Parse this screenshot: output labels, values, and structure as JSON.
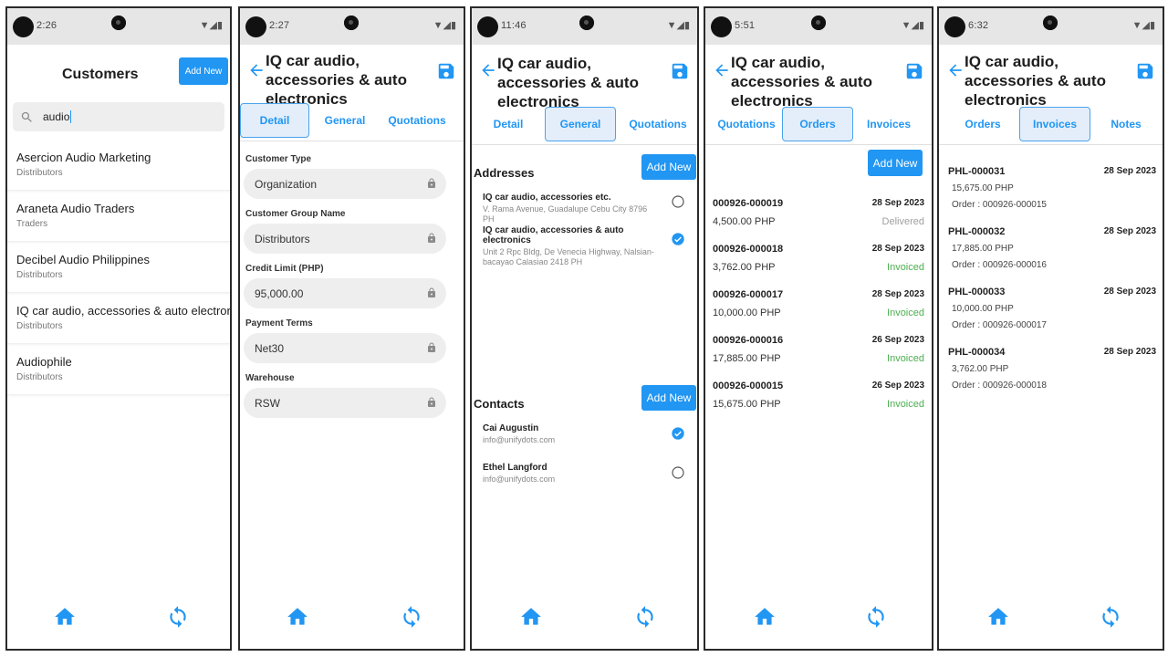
{
  "colors": {
    "accent": "#2196f3",
    "delivered": "#9e9e9e",
    "invoiced": "#4caf50"
  },
  "screen1": {
    "status_time": "2:26",
    "title": "Customers",
    "add_new": "Add New",
    "search_value": "audio",
    "customers": [
      {
        "name": "Asercion Audio Marketing",
        "group": "Distributors"
      },
      {
        "name": "Araneta Audio Traders",
        "group": "Traders"
      },
      {
        "name": "Decibel Audio Philippines",
        "group": "Distributors"
      },
      {
        "name": "IQ car audio, accessories & auto electronics",
        "group": "Distributors"
      },
      {
        "name": "Audiophile",
        "group": "Distributors"
      }
    ]
  },
  "screen2": {
    "status_time": "2:27",
    "title": "IQ car audio, accessories & auto electronics",
    "tabs": [
      "Detail",
      "General",
      "Quotations"
    ],
    "fields": [
      {
        "label": "Customer Type",
        "value": "Organization"
      },
      {
        "label": "Customer Group Name",
        "value": "Distributors"
      },
      {
        "label": "Credit Limit (PHP)",
        "value": "95,000.00"
      },
      {
        "label": "Payment Terms",
        "value": "Net30"
      },
      {
        "label": "Warehouse",
        "value": "RSW"
      }
    ]
  },
  "screen3": {
    "status_time": "11:46",
    "title": "IQ car audio, accessories & auto electronics",
    "tabs": [
      "Detail",
      "General",
      "Quotations"
    ],
    "addresses_heading": "Addresses",
    "contacts_heading": "Contacts",
    "add_new": "Add New",
    "addresses": [
      {
        "name": "IQ car audio, accessories etc.",
        "line": "V. Rama Avenue, Guadalupe  Cebu City  8796 PH",
        "selected": false
      },
      {
        "name": "IQ car audio, accessories & auto electronics",
        "line": "Unit 2 Rpc Bldg, De Venecia Highway, Nalsian-bacayao  Calasiao  2418 PH",
        "selected": true
      }
    ],
    "contacts": [
      {
        "name": "Cai Augustin",
        "email": "info@unifydots.com",
        "selected": true
      },
      {
        "name": "Ethel Langford",
        "email": "info@unifydots.com",
        "selected": false
      }
    ]
  },
  "screen4": {
    "status_time": "5:51",
    "title": "IQ car audio, accessories & auto electronics",
    "tabs": [
      "Quotations",
      "Orders",
      "Invoices"
    ],
    "add_new": "Add New",
    "orders": [
      {
        "number": "000926-000019",
        "date": "28 Sep 2023",
        "amount": "4,500.00 PHP",
        "status": "Delivered"
      },
      {
        "number": "000926-000018",
        "date": "28 Sep 2023",
        "amount": "3,762.00 PHP",
        "status": "Invoiced"
      },
      {
        "number": "000926-000017",
        "date": "28 Sep 2023",
        "amount": "10,000.00 PHP",
        "status": "Invoiced"
      },
      {
        "number": "000926-000016",
        "date": "26 Sep 2023",
        "amount": "17,885.00 PHP",
        "status": "Invoiced"
      },
      {
        "number": "000926-000015",
        "date": "26 Sep 2023",
        "amount": "15,675.00 PHP",
        "status": "Invoiced"
      }
    ]
  },
  "screen5": {
    "status_time": "6:32",
    "title": "IQ car audio, accessories & auto electronics",
    "tabs": [
      "Orders",
      "Invoices",
      "Notes"
    ],
    "invoices": [
      {
        "number": "PHL-000031",
        "date": "28 Sep 2023",
        "amount": "15,675.00 PHP",
        "order": "Order : 000926-000015"
      },
      {
        "number": "PHL-000032",
        "date": "28 Sep 2023",
        "amount": "17,885.00 PHP",
        "order": "Order : 000926-000016"
      },
      {
        "number": "PHL-000033",
        "date": "28 Sep 2023",
        "amount": "10,000.00 PHP",
        "order": "Order : 000926-000017"
      },
      {
        "number": "PHL-000034",
        "date": "28 Sep 2023",
        "amount": "3,762.00 PHP",
        "order": "Order : 000926-000018"
      }
    ]
  }
}
